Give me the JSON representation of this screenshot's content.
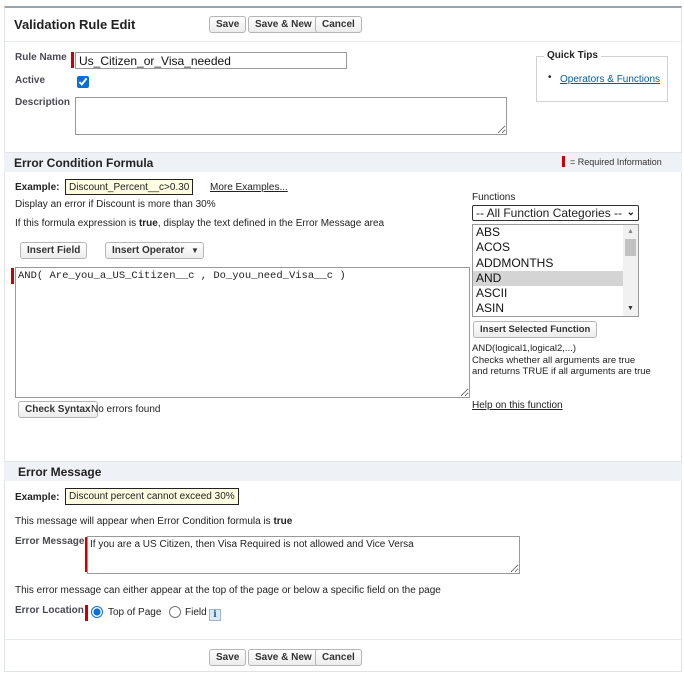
{
  "header": {
    "title": "Validation Rule Edit",
    "save": "Save",
    "save_new": "Save & New",
    "cancel": "Cancel"
  },
  "rule": {
    "name_label": "Rule Name",
    "name_value": "Us_Citizen_or_Visa_needed",
    "active_label": "Active",
    "active": true,
    "description_label": "Description",
    "description_value": ""
  },
  "quick_tips": {
    "title": "Quick Tips",
    "link": "Operators & Functions"
  },
  "formula_section": {
    "title": "Error Condition Formula",
    "required_info": "= Required Information",
    "example_label": "Example:",
    "example_value": "Discount_Percent__c>0.30",
    "more_examples": "More Examples...",
    "hint1": "Display an error if Discount is more than 30%",
    "hint2_prefix": "If this formula expression is ",
    "hint2_bold": "true",
    "hint2_suffix": ", display the text defined in the Error Message area",
    "insert_field": "Insert Field",
    "insert_operator": "Insert Operator",
    "formula": "AND( Are_you_a_US_Citizen__c , Do_you_need_Visa__c )",
    "check_syntax": "Check Syntax",
    "syntax_status": "No errors found"
  },
  "functions": {
    "label": "Functions",
    "category": "-- All Function Categories --",
    "items": [
      "ABS",
      "ACOS",
      "ADDMONTHS",
      "AND",
      "ASCII",
      "ASIN"
    ],
    "selected": "AND",
    "insert_selected": "Insert Selected Function",
    "signature": "AND(logical1,logical2,...)",
    "description": "Checks whether all arguments are true and returns TRUE if all arguments are true",
    "help_link": "Help on this function"
  },
  "error_section": {
    "title": "Error Message",
    "example_label": "Example:",
    "example_value": "Discount percent cannot exceed 30%",
    "appear_prefix": "This message will appear when Error Condition formula is ",
    "appear_bold": "true",
    "message_label": "Error Message",
    "message_value": "If you are a US Citizen, then Visa Required is not allowed and Vice Versa",
    "location_hint": "This error message can either appear at the top of the page or below a specific field on the page",
    "location_label": "Error Location",
    "option_top": "Top of Page",
    "option_field": "Field",
    "selected_location": "Top of Page",
    "info_glyph": "i"
  },
  "colors": {
    "required": "#cc0000",
    "link": "#015ba7",
    "section_bg": "#eef1f6",
    "example_bg": "#fefde1"
  }
}
